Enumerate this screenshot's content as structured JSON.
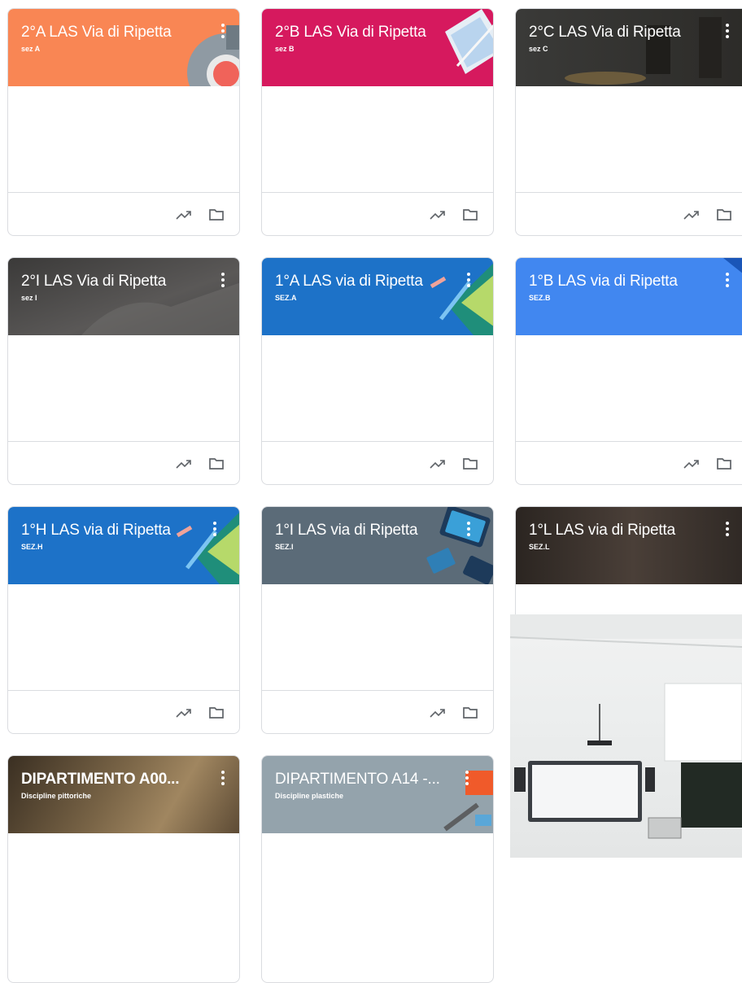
{
  "classes": [
    {
      "title": "2°A LAS Via di Ripetta",
      "section": "sez A",
      "theme": "orange",
      "color": "#f98654"
    },
    {
      "title": "2°B LAS Via di Ripetta",
      "section": "sez B",
      "theme": "pink",
      "color": "#d6195e"
    },
    {
      "title": "2°C LAS Via di Ripetta",
      "section": "sez C",
      "theme": "photo-dark",
      "color": "#3a3a38"
    },
    {
      "title": "2°I LAS Via di Ripetta",
      "section": "sez I",
      "theme": "photo-grey",
      "color": "#4a4a48"
    },
    {
      "title": "1°A LAS via di Ripetta",
      "section": "SEZ.A",
      "theme": "blue",
      "color": "#1d72c8"
    },
    {
      "title": "1°B LAS via di Ripetta",
      "section": "SEZ.B",
      "theme": "lightblue",
      "color": "#4187f0"
    },
    {
      "title": "1°H LAS via di Ripetta",
      "section": "SEZ.H",
      "theme": "blue",
      "color": "#1d72c8"
    },
    {
      "title": "1°I LAS via di Ripetta",
      "section": "SEZ.I",
      "theme": "slate",
      "color": "#5b6b78"
    },
    {
      "title": "1°L LAS via di Ripetta",
      "section": "SEZ.L",
      "theme": "photo-brown",
      "color": "#3e3631"
    },
    {
      "title": "DIPARTIMENTO A00...",
      "section": "Discipline pittoriche",
      "theme": "photo-sepia",
      "color": "#6d5a3e"
    },
    {
      "title": "DIPARTIMENTO A14 -...",
      "section": "Discipline plastiche",
      "theme": "grey",
      "color": "#94a3ac"
    }
  ],
  "icons": {
    "menu": "more-vert-icon",
    "trend": "trending-up-icon",
    "folder": "folder-icon"
  }
}
